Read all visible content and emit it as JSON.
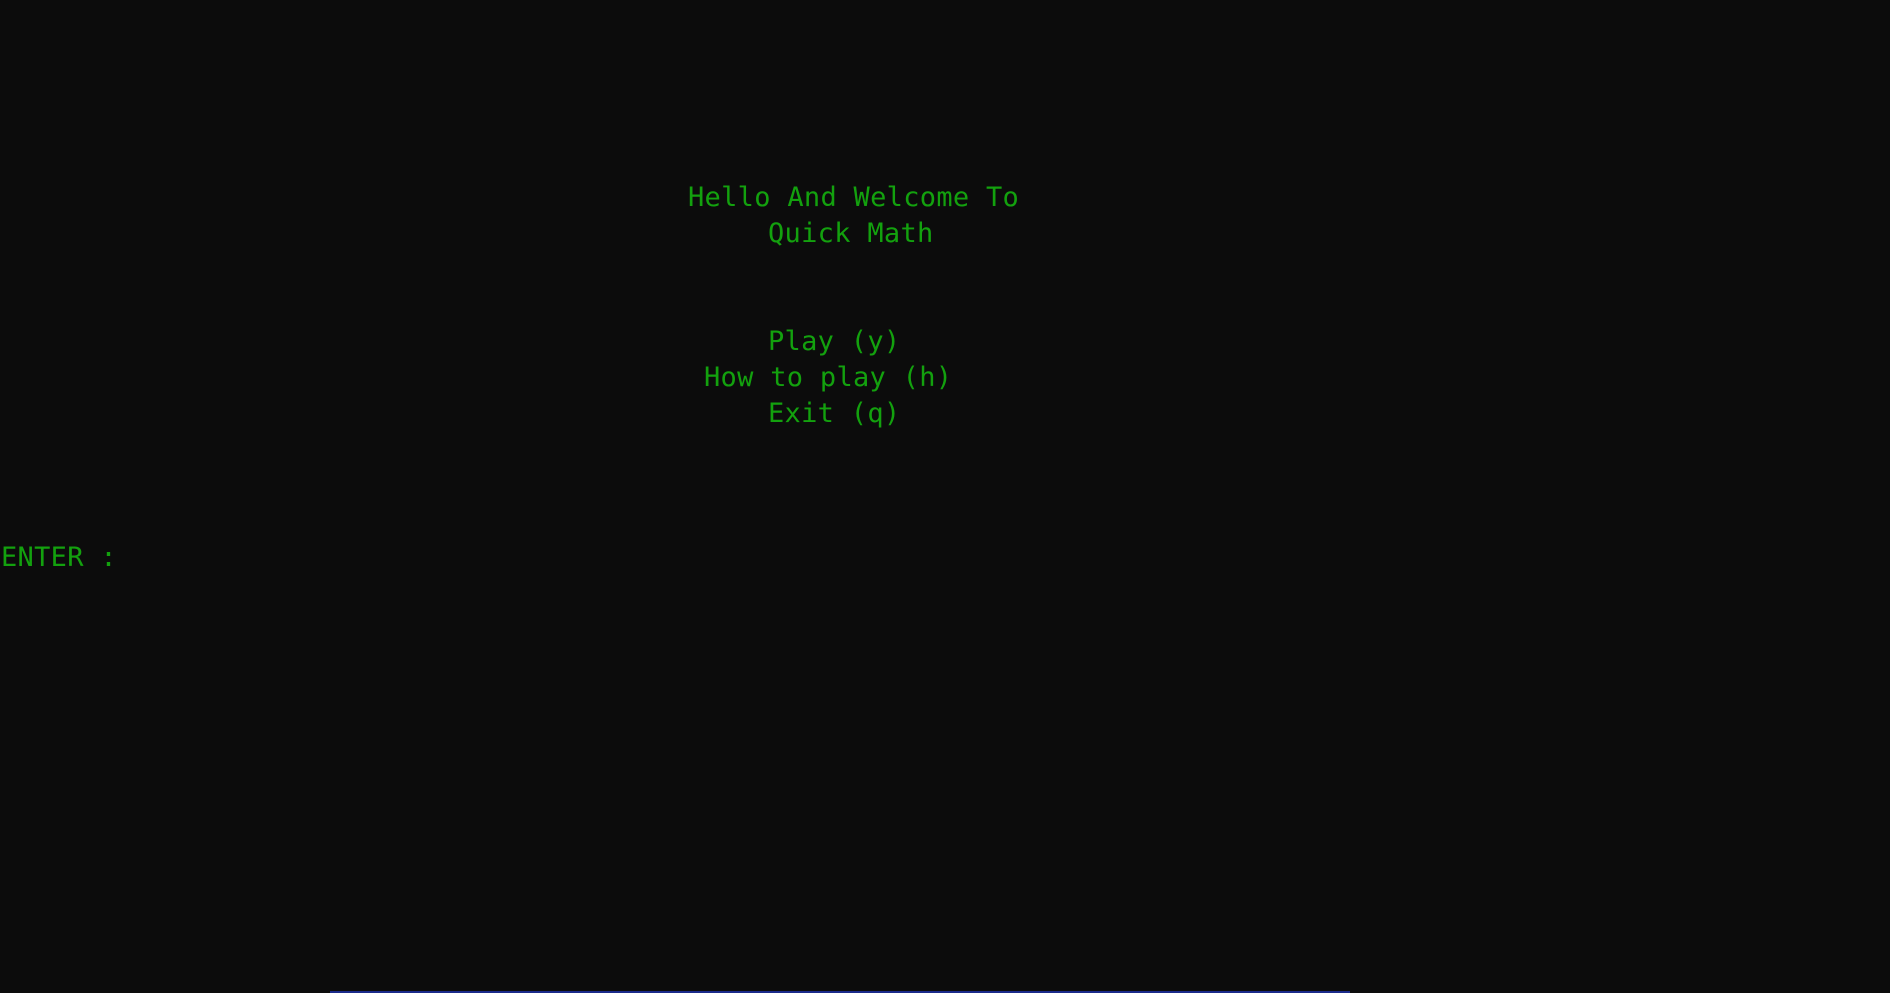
{
  "colors": {
    "background": "#0c0c0c",
    "text": "#13a10e",
    "bottom_accent": "#1a2a8a"
  },
  "welcome": {
    "line1": "Hello And Welcome To",
    "line2": "Quick Math"
  },
  "menu": {
    "play": "Play (y)",
    "how_to_play": "How to play (h)",
    "exit": "Exit (q)"
  },
  "prompt": {
    "label": "ENTER :",
    "value": ""
  }
}
